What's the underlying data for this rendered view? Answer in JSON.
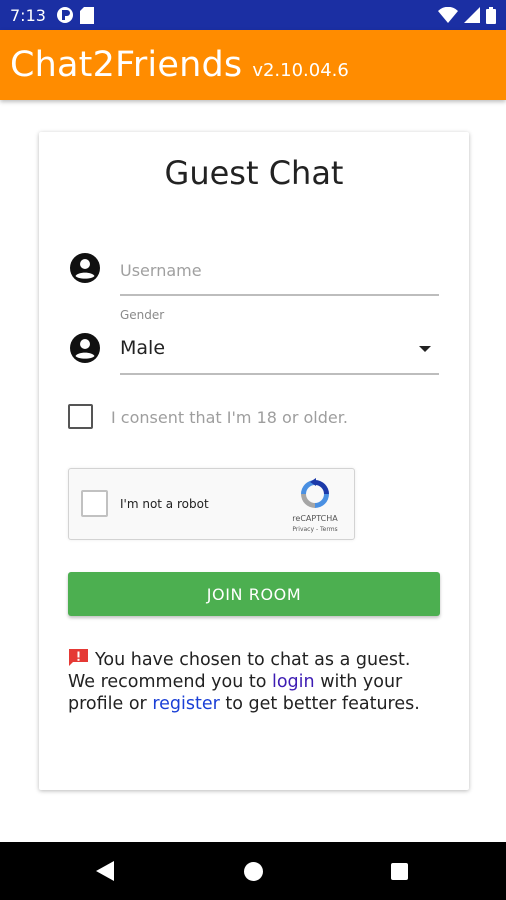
{
  "status_bar": {
    "time": "7:13",
    "icons": [
      "notification-app-icon",
      "sd-card-icon",
      "wifi-icon",
      "cell-signal-icon",
      "battery-icon"
    ]
  },
  "app_bar": {
    "title": "Chat2Friends",
    "version": "v2.10.04.6",
    "color": "#ff8c00"
  },
  "card": {
    "title": "Guest Chat",
    "username": {
      "placeholder": "Username",
      "value": "",
      "icon": "account-circle-icon"
    },
    "gender": {
      "label": "Gender",
      "value": "Male",
      "icon": "account-circle-icon"
    },
    "consent": {
      "checked": false,
      "label": "I consent that I'm 18 or older."
    },
    "recaptcha": {
      "checked": false,
      "label": "I'm not a robot",
      "brand": "reCAPTCHA",
      "links": "Privacy - Terms"
    },
    "join_button": {
      "label": "JOIN ROOM",
      "color": "#4caf50"
    },
    "notice": {
      "icon": "alert-message-icon",
      "text_1": "You have chosen to chat as a guest. We recommend you to ",
      "login_link": "login",
      "text_2": " with your profile or ",
      "register_link": "register",
      "text_3": " to get better features."
    }
  },
  "nav_bar": {
    "buttons": [
      "back-icon",
      "home-icon",
      "recent-apps-icon"
    ]
  }
}
